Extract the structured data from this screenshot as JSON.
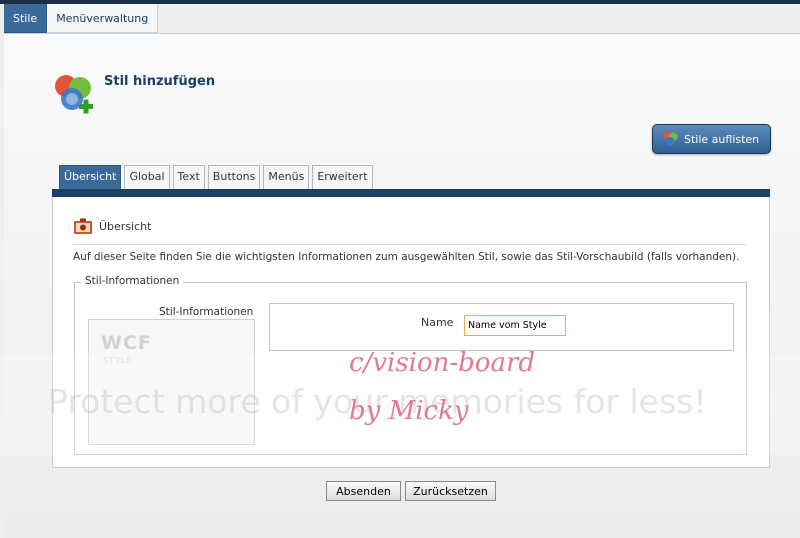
{
  "nav": {
    "tabs": [
      {
        "label": "Stile",
        "active": true
      },
      {
        "label": "Menüverwaltung",
        "active": false
      }
    ]
  },
  "page": {
    "title": "Stil hinzufügen",
    "list_button": "Stile auflisten"
  },
  "tabs": [
    {
      "label": "Übersicht",
      "active": true
    },
    {
      "label": "Global",
      "active": false
    },
    {
      "label": "Text",
      "active": false
    },
    {
      "label": "Buttons",
      "active": false
    },
    {
      "label": "Menüs",
      "active": false
    },
    {
      "label": "Erweitert",
      "active": false
    }
  ],
  "section": {
    "title": "Übersicht",
    "description": "Auf dieser Seite finden Sie die wichtigsten Informationen zum ausgewählten Stil, sowie das Stil-Vorschaubild (falls vorhanden)."
  },
  "fieldset": {
    "legend": "Stil-Informationen",
    "preview_label": "Stil-Informationen",
    "preview_logo": "WCF",
    "preview_logo_sub": "STYLE",
    "name_label": "Name",
    "name_value": "Name vom Style"
  },
  "watermark": {
    "text": "Protect more of your memories for less!",
    "signature_line1": "c/vision-board",
    "signature_line2": "by Micky"
  },
  "form": {
    "submit": "Absenden",
    "reset": "Zurücksetzen"
  },
  "colors": {
    "accent": "#3b6a98",
    "dark_bar": "#1c3f66",
    "input_focus_border": "#f0a94a",
    "signature": "#e07a8f"
  }
}
